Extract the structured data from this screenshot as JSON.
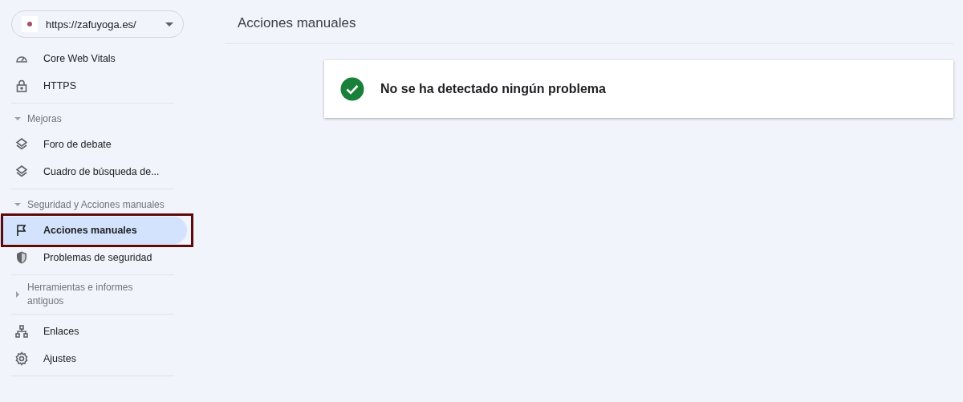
{
  "property": {
    "url": "https://zafuyoga.es/"
  },
  "sidebar": {
    "groups": [
      {
        "items": [
          {
            "label": "Core Web Vitals",
            "selected": false,
            "annotated": false
          },
          {
            "label": "HTTPS",
            "selected": false,
            "annotated": false
          }
        ]
      },
      {
        "heading": "Mejoras",
        "expanded": true,
        "items": [
          {
            "label": "Foro de debate",
            "selected": false,
            "annotated": false
          },
          {
            "label": "Cuadro de búsqueda de...",
            "selected": false,
            "annotated": false
          }
        ]
      },
      {
        "heading": "Seguridad y Acciones manuales",
        "expanded": true,
        "items": [
          {
            "label": "Acciones manuales",
            "selected": true,
            "annotated": true
          },
          {
            "label": "Problemas de seguridad",
            "selected": false,
            "annotated": false
          }
        ]
      },
      {
        "heading": "Herramientas e informes antiguos",
        "expanded": false
      },
      {
        "items": [
          {
            "label": "Enlaces",
            "selected": false,
            "annotated": false
          },
          {
            "label": "Ajustes",
            "selected": false,
            "annotated": false
          }
        ]
      }
    ]
  },
  "page": {
    "title": "Acciones manuales",
    "status": {
      "message": "No se ha detectado ningún problema"
    }
  }
}
